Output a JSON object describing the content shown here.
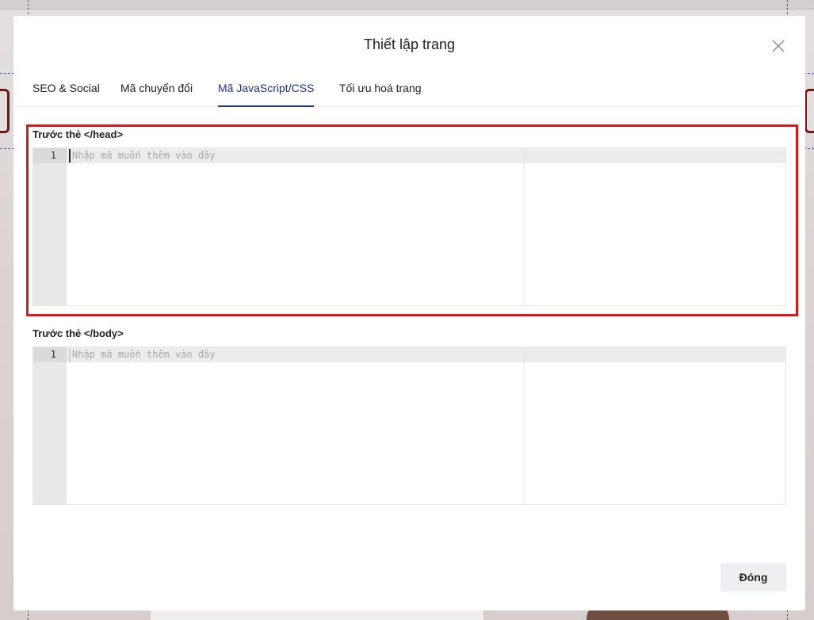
{
  "modal": {
    "title": "Thiết lập trang"
  },
  "tabs": [
    {
      "label": "SEO & Social"
    },
    {
      "label": "Mã chuyển đổi"
    },
    {
      "label": "Mã JavaScript/CSS",
      "active": true
    },
    {
      "label": "Tối ưu hoá trang"
    }
  ],
  "head_editor": {
    "label": "Trước thẻ </head>",
    "line_number": "1",
    "placeholder": "Nhập mã muốn thêm vào đây",
    "value": ""
  },
  "body_editor": {
    "label": "Trước thẻ </body>",
    "line_number": "1",
    "placeholder": "Nhập mã muốn thêm vào đây",
    "value": ""
  },
  "footer": {
    "close_label": "Đóng"
  },
  "colors": {
    "accent": "#1d2f9b",
    "highlight": "#e0161a"
  },
  "icons": {
    "close": "close-icon"
  }
}
